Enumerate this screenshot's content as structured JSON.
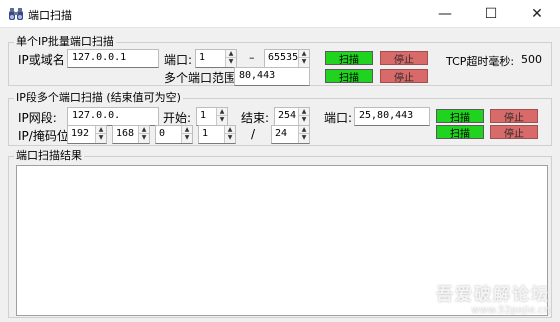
{
  "window": {
    "title": "端口扫描",
    "minimize_glyph": "—",
    "maximize_glyph": "☐",
    "close_glyph": "✕"
  },
  "single_ip": {
    "group_label": "单个IP批量端口扫描",
    "host_label": "IP或域名",
    "host_value": "127.0.0.1",
    "port_label": "端口:",
    "port_from": "1",
    "dash": "–",
    "port_to": "65535",
    "multi_port_label": "多个端口范围",
    "multi_port_value": "80,443",
    "scan_label": "扫描",
    "stop_label": "停止",
    "timeout_label": "TCP超时毫秒:",
    "timeout_value": "500"
  },
  "ip_range": {
    "group_label": "IP段多个端口扫描 (结束值可为空)",
    "segment_label": "IP网段:",
    "segment_value": "127.0.0.",
    "start_label": "开始:",
    "start_value": "1",
    "end_label": "结束:",
    "end_value": "254",
    "port_label": "端口:",
    "port_value": "25,80,443",
    "mask_label": "IP/掩码位",
    "mask_octets": [
      "192",
      "168",
      "0",
      "1"
    ],
    "slash": "/",
    "mask_bits": "24",
    "scan_label": "扫描",
    "stop_label": "停止"
  },
  "results": {
    "group_label": "端口扫描结果",
    "content": ""
  },
  "watermark": {
    "line1": "吾爱破解论坛",
    "line2": "www.52pojie.cn"
  },
  "colors": {
    "scan_button": "#1fd31f",
    "stop_button": "#d96a6a"
  }
}
